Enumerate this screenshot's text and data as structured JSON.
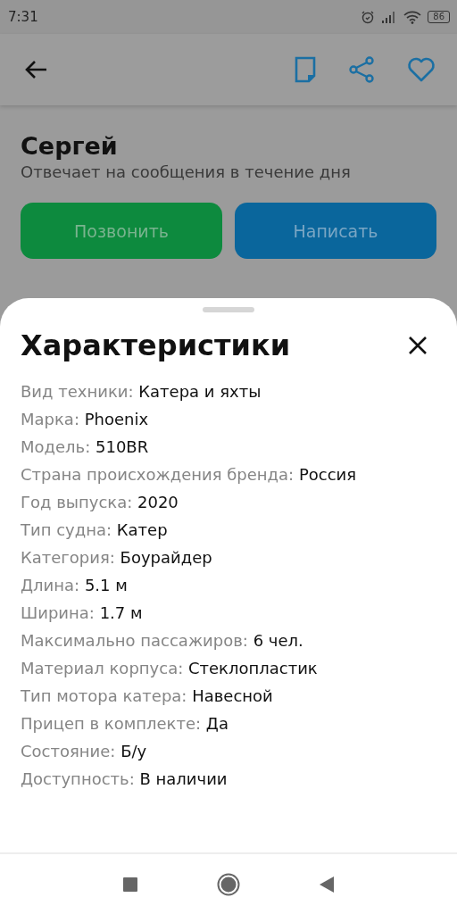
{
  "status_bar": {
    "time": "7:31",
    "battery": "86"
  },
  "seller": {
    "name": "Сергей",
    "response_note": "Отвечает на сообщения в течение дня"
  },
  "actions": [
    {
      "kind": "call",
      "label": "Позвонить"
    },
    {
      "kind": "message",
      "label": "Написать"
    }
  ],
  "sheet": {
    "title": "Характеристики",
    "specs": [
      {
        "label": "Вид техники:",
        "value": "Катера и яхты"
      },
      {
        "label": "Марка:",
        "value": "Phoenix"
      },
      {
        "label": "Модель:",
        "value": "510BR"
      },
      {
        "label": "Страна происхождения бренда:",
        "value": "Россия"
      },
      {
        "label": "Год выпуска:",
        "value": "2020"
      },
      {
        "label": "Тип судна:",
        "value": "Катер"
      },
      {
        "label": "Категория:",
        "value": "Боурайдер"
      },
      {
        "label": "Длина:",
        "value": "5.1 м"
      },
      {
        "label": "Ширина:",
        "value": "1.7 м"
      },
      {
        "label": "Максимально пассажиров:",
        "value": "6 чел."
      },
      {
        "label": "Материал корпуса:",
        "value": "Стеклопластик"
      },
      {
        "label": "Тип мотора катера:",
        "value": "Навесной"
      },
      {
        "label": "Прицеп в комплекте:",
        "value": "Да"
      },
      {
        "label": "Состояние:",
        "value": "Б/у"
      },
      {
        "label": "Доступность:",
        "value": "В наличии"
      }
    ]
  }
}
